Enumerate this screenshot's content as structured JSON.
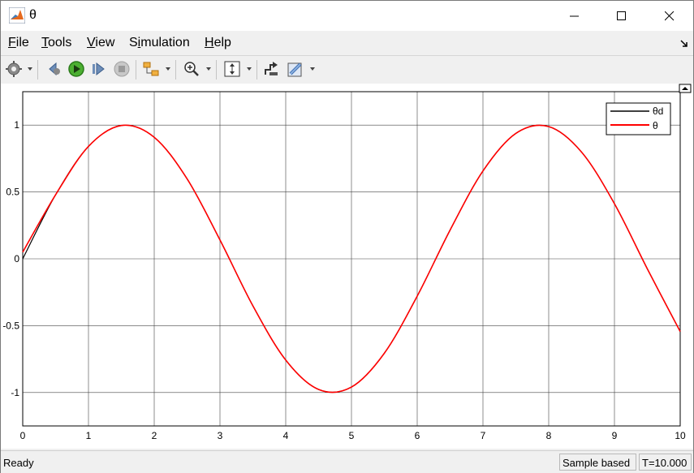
{
  "window": {
    "title": "θ",
    "icons": {
      "app": "matlab-logo-icon",
      "minimize": "minimize-icon",
      "maximize": "maximize-icon",
      "close": "close-icon"
    }
  },
  "menu": {
    "items": [
      {
        "label_underlined": "F",
        "label_rest": "ile"
      },
      {
        "label_underlined": "T",
        "label_rest": "ools"
      },
      {
        "label_underlined": "V",
        "label_rest": "iew"
      },
      {
        "label_pre": "S",
        "label_underlined": "i",
        "label_rest": "mulation"
      },
      {
        "label_underlined": "H",
        "label_rest": "elp"
      }
    ],
    "dock_icon": "dock-arrow-icon"
  },
  "toolbar": {
    "buttons": [
      "settings-gear-icon",
      "step-back-icon",
      "run-icon",
      "step-forward-icon",
      "stop-icon",
      "highlight-block-icon",
      "zoom-in-icon",
      "autoscale-icon",
      "signal-selector-icon",
      "measurement-ruler-icon"
    ]
  },
  "chart_data": {
    "type": "line",
    "title": "",
    "xlabel": "",
    "ylabel": "",
    "xlim": [
      0,
      10
    ],
    "ylim": [
      -1.25,
      1.25
    ],
    "xticks": [
      "0",
      "1",
      "2",
      "3",
      "4",
      "5",
      "6",
      "7",
      "8",
      "9",
      "10"
    ],
    "yticks": [
      "1",
      "0.5",
      "0",
      "-0.5",
      "-1"
    ],
    "ytick_values": [
      1,
      0.5,
      0,
      -0.5,
      -1
    ],
    "grid": true,
    "legend_placement": "top-right",
    "series": [
      {
        "name": "θd",
        "color": "#000000",
        "x": [
          0,
          0.5,
          1,
          1.5,
          2,
          2.5,
          3,
          3.5,
          4,
          4.5,
          5,
          5.5,
          6,
          6.5,
          7,
          7.5,
          8,
          8.5,
          9,
          9.5,
          10
        ],
        "y": [
          0,
          0.479,
          0.841,
          0.997,
          0.909,
          0.598,
          0.141,
          -0.351,
          -0.757,
          -0.977,
          -0.959,
          -0.706,
          -0.279,
          0.215,
          0.657,
          0.938,
          0.989,
          0.798,
          0.412,
          -0.075,
          -0.544
        ]
      },
      {
        "name": "θ",
        "color": "#ff0000",
        "x": [
          0,
          0.5,
          1,
          1.5,
          2,
          2.5,
          3,
          3.5,
          4,
          4.5,
          5,
          5.5,
          6,
          6.5,
          7,
          7.5,
          8,
          8.5,
          9,
          9.5,
          10
        ],
        "y": [
          0.05,
          0.479,
          0.841,
          0.997,
          0.909,
          0.598,
          0.141,
          -0.351,
          -0.757,
          -0.977,
          -0.959,
          -0.706,
          -0.279,
          0.215,
          0.657,
          0.938,
          0.989,
          0.798,
          0.412,
          -0.075,
          -0.544
        ]
      }
    ]
  },
  "status": {
    "ready": "Ready",
    "sample_mode": "Sample based",
    "time": "T=10.000"
  }
}
